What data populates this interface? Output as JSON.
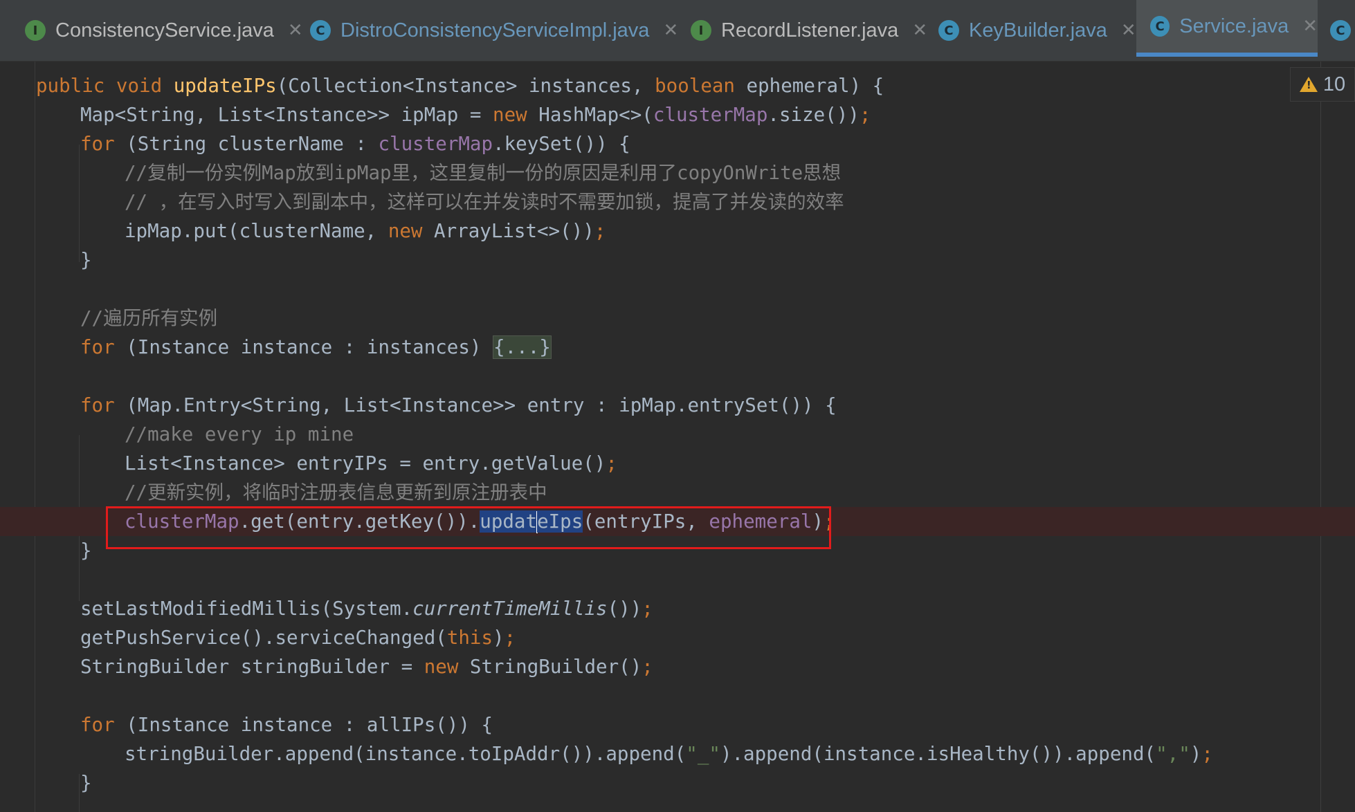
{
  "tabs": [
    {
      "label": "ConsistencyService.java",
      "kind": "I",
      "color": "#bbbbbb",
      "active": false
    },
    {
      "label": "DistroConsistencyServiceImpl.java",
      "kind": "C",
      "color": "#6897bb",
      "active": false
    },
    {
      "label": "RecordListener.java",
      "kind": "I",
      "color": "#bbbbbb",
      "active": false
    },
    {
      "label": "KeyBuilder.java",
      "kind": "C",
      "color": "#6897bb",
      "active": false
    },
    {
      "label": "Service.java",
      "kind": "C",
      "color": "#6897bb",
      "active": true
    },
    {
      "label": "",
      "kind": "C",
      "color": "#6897bb",
      "active": false
    }
  ],
  "close_glyph": "✕",
  "inspection": {
    "count": "10"
  },
  "code": {
    "l1": {
      "kw1": "public",
      "kw2": "void",
      "name": "updateIPs",
      "p1": "(Collection<Instance> instances, ",
      "kw3": "boolean",
      "p2": " ephemeral) {"
    },
    "l2": {
      "a": "Map<String, List<Instance>> ipMap = ",
      "kw": "new",
      "b": " HashMap<>(",
      "fld": "clusterMap",
      "c": ".size())",
      "semi": ";"
    },
    "l3": {
      "kw": "for",
      "a": " (String clusterName : ",
      "fld": "clusterMap",
      "b": ".keySet()) {"
    },
    "l4": {
      "cm": "//复制一份实例Map放到ipMap里，这里复制一份的原因是利用了copyOnWrite思想"
    },
    "l5": {
      "cm": "// ，在写入时写入到副本中，这样可以在并发读时不需要加锁，提高了并发读的效率"
    },
    "l6": {
      "a": "ipMap.put(clusterName, ",
      "kw": "new",
      "b": " ArrayList<>())",
      "semi": ";"
    },
    "l7": {
      "a": "}"
    },
    "l9": {
      "cm": "//遍历所有实例"
    },
    "l10": {
      "kw": "for",
      "a": " (Instance instance : instances) ",
      "fold": "{...}"
    },
    "l12": {
      "kw": "for",
      "a": " (Map.Entry<String, List<Instance>> entry : ipMap.entrySet()) {"
    },
    "l13": {
      "cm": "//make every ip mine"
    },
    "l14": {
      "a": "List<Instance> entryIPs = entry.getValue()",
      "semi": ";"
    },
    "l15": {
      "cm": "//更新实例，将临时注册表信息更新到原注册表中"
    },
    "l16": {
      "fld": "clusterMap",
      "a": ".get(entry.getKey()).",
      "sel1": "updat",
      "sel2": "eIps",
      "b": "(entryIPs, ",
      "fld2": "ephemeral",
      "c": ")",
      "semi": ";"
    },
    "l17": {
      "a": "}"
    },
    "l19": {
      "a": "setLastModifiedMillis(System.",
      "it": "currentTimeMillis",
      "b": "())",
      "semi": ";"
    },
    "l20": {
      "a": "getPushService().serviceChanged(",
      "kw": "this",
      "b": ")",
      "semi": ";"
    },
    "l21": {
      "a": "StringBuilder stringBuilder = ",
      "kw": "new",
      "b": " StringBuilder()",
      "semi": ";"
    },
    "l23": {
      "kw": "for",
      "a": " (Instance instance : allIPs()) {"
    },
    "l24": {
      "a": "stringBuilder.append(instance.toIpAddr()).append(",
      "s1": "\"_\"",
      "b": ").append(instance.isHealthy()).append(",
      "s2": "\",\"",
      "c": ")",
      "semi": ";"
    },
    "l25": {
      "a": "}"
    }
  }
}
